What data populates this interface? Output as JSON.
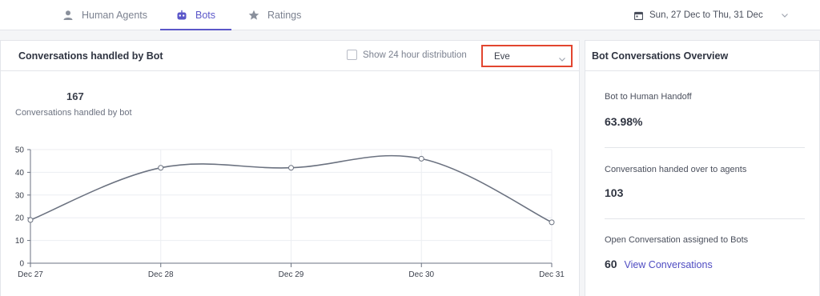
{
  "tabs": {
    "human_agents": "Human Agents",
    "bots": "Bots",
    "ratings": "Ratings"
  },
  "date_range": {
    "label": "Sun, 27 Dec to Thu, 31 Dec"
  },
  "left_panel": {
    "title": "Conversations handled by Bot",
    "toggle_label": "Show 24 hour distribution",
    "toggle_checked": false,
    "bot_select_value": "Eve",
    "kpi_value": "167",
    "kpi_label": "Conversations handled by bot"
  },
  "right_panel": {
    "title": "Bot Conversations Overview",
    "stats": [
      {
        "label": "Bot to Human Handoff",
        "value": "63.98%"
      },
      {
        "label": "Conversation handed over to agents",
        "value": "103"
      },
      {
        "label": "Open Conversation assigned to Bots",
        "value": "60",
        "link": "View Conversations"
      }
    ]
  },
  "colors": {
    "accent": "#5b57c9",
    "highlight_border": "#e2452f",
    "line": "#6b7280"
  },
  "chart_data": {
    "type": "line",
    "categories": [
      "Dec 27",
      "Dec 28",
      "Dec 29",
      "Dec 30",
      "Dec 31"
    ],
    "values": [
      19,
      42,
      42,
      46,
      18
    ],
    "ylim": [
      0,
      50
    ],
    "yticks": [
      0,
      10,
      20,
      30,
      40,
      50
    ],
    "grid": true
  }
}
